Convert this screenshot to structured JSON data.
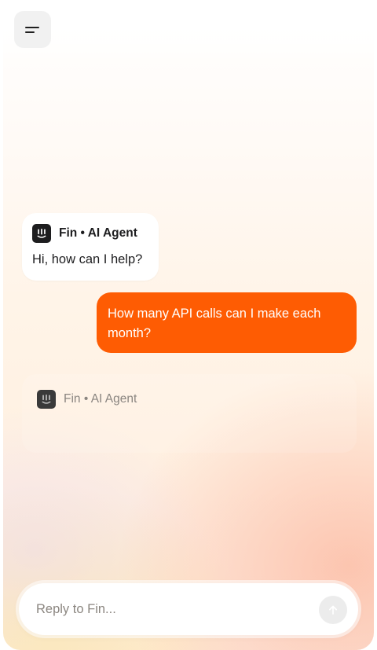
{
  "header": {
    "menu_icon": "menu-icon"
  },
  "messages": [
    {
      "role": "agent",
      "agent_label": "Fin • AI Agent",
      "text": "Hi, how can I help?",
      "icon": "fin-logo-icon"
    },
    {
      "role": "user",
      "text": "How many API calls can I make each month?"
    },
    {
      "role": "agent-pending",
      "agent_label": "Fin • AI Agent",
      "icon": "fin-logo-icon"
    }
  ],
  "composer": {
    "placeholder": "Reply to Fin...",
    "value": "",
    "send_icon": "arrow-up-icon"
  },
  "colors": {
    "accent": "#fe5c03",
    "agent_logo": "#1d1d1f"
  }
}
